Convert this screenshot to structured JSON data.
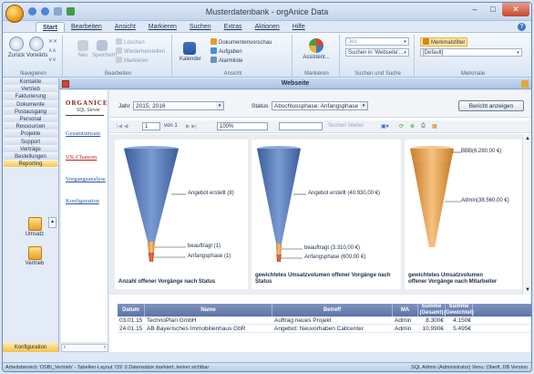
{
  "window": {
    "title": "Musterdatenbank - orgAnice Data",
    "minimize": "–",
    "maximize": "□",
    "close": "✕"
  },
  "tabs": [
    "Start",
    "Bearbeiten",
    "Ansicht",
    "Markieren",
    "Suchen",
    "Extras",
    "Aktionen",
    "Hilfe"
  ],
  "ribbon": {
    "navigation": {
      "label": "Navigieren",
      "back": "Zurück",
      "forward": "Vorwärts"
    },
    "edit": {
      "label": "Bearbeiten",
      "new": "Neu",
      "save": "Speichern",
      "delete": "Löschen",
      "restore": "Wiederherstellen",
      "mark": "Markieren"
    },
    "view": {
      "label": "Ansicht",
      "calendar": "Kalender",
      "documents": "Dokumentenvorschau",
      "tasks": "Aufgaben",
      "lists": "Alarmliste"
    },
    "markers": {
      "label": "Markieren",
      "assistant": "Assistent..."
    },
    "search": {
      "label": "Suchen und Suche",
      "value": "Suchen in 'Webseite'..."
    },
    "fields": {
      "label": "Merkmale",
      "title": "Merkmalsfilter",
      "value": "[Default]"
    }
  },
  "nav": {
    "items": [
      "Kontakte",
      "Vertrieb",
      "Fakturierung",
      "Dokumente",
      "Postausgang",
      "Personal",
      "Ressourcen",
      "Projekte",
      "Support",
      "Verträge",
      "Bestellungen",
      "Reporting"
    ],
    "active": "Reporting",
    "icons": [
      "Umsatz",
      "Vertrieb"
    ],
    "footer": "Konfiguration"
  },
  "panel": {
    "title": "Webseite"
  },
  "linkpane": {
    "logo_top": "ORGANICE",
    "logo_bottom": "SQL Server",
    "links": [
      "Gesamtumsatz",
      "VK-Chancen",
      "Vorgangsanalyse",
      "Konfiguration"
    ]
  },
  "filter": {
    "year_label": "Jahr",
    "year_value": "2015; 2016",
    "status_label": "Status",
    "status_value": "Abschlussphase; Anfangsphase",
    "button": "Bericht anzeigen"
  },
  "report_toolbar": {
    "page": "1",
    "of": "von 1",
    "zoom": "100%",
    "search_hint": "Suchen",
    "next": "Weiter"
  },
  "charts": [
    {
      "type": "funnel",
      "title": "Anzahl offener Vorgänge nach Status",
      "segments": [
        {
          "label": "Angebot erstellt (8)",
          "value": 8
        },
        {
          "label": "beauftragt (1)",
          "value": 1
        },
        {
          "label": "Anfangsphase (1)",
          "value": 1
        }
      ]
    },
    {
      "type": "funnel",
      "title": "gewichtetes Umsatzvolumen offener Vorgänge nach Status",
      "segments": [
        {
          "label": "Angebot erstellt (40.930,00 €)",
          "value": 40930
        },
        {
          "label": "beauftragt (3.310,00 €)",
          "value": 3310
        },
        {
          "label": "Anfangsphase (600,00 €)",
          "value": 600
        }
      ]
    },
    {
      "type": "funnel",
      "title": "gewichtetes Umsatzvolumen offener Vorgänge nach Mitarbeiter",
      "segments": [
        {
          "label": "BBB(6.280,00 €)",
          "value": 6280
        },
        {
          "label": "Admin(38.560,00 €)",
          "value": 38560
        }
      ]
    }
  ],
  "chart_data": [
    {
      "type": "funnel",
      "title": "Anzahl offener Vorgänge nach Status",
      "categories": [
        "Angebot erstellt",
        "beauftragt",
        "Anfangsphase"
      ],
      "values": [
        8,
        1,
        1
      ]
    },
    {
      "type": "funnel",
      "title": "gewichtetes Umsatzvolumen offener Vorgänge nach Status",
      "categories": [
        "Angebot erstellt",
        "beauftragt",
        "Anfangsphase"
      ],
      "values": [
        40930,
        3310,
        600
      ]
    },
    {
      "type": "funnel",
      "title": "gewichtetes Umsatzvolumen offener Vorgänge nach Mitarbeiter",
      "categories": [
        "BBB",
        "Admin"
      ],
      "values": [
        6280,
        38560
      ]
    }
  ],
  "table": {
    "headers": [
      "Datum",
      "Name",
      "Betreff",
      "MA",
      "Summe (Gesamt)",
      "Summe (Gewichtet)"
    ],
    "rows": [
      [
        "03.01.15",
        "TechnoPlan GmbH",
        "Auftrag neues Projekt",
        "Admin",
        "8.300€",
        "4.150€"
      ],
      [
        "24.01.15",
        "AB Bayerisches Immobilienhaus GbR",
        "Angebot: Neuvorhaben Callcenter",
        "Admin",
        "10.990€",
        "5.495€"
      ]
    ]
  },
  "status": {
    "left": "Arbeitsbereich 'OSBI_Vertrieb' - Tabellen-Layout 'OS' 0 Datensätze markiert, keiner sichtbar",
    "right": "SQL Admin (Administrator)   Venu: Oberfl, DB Version"
  },
  "colors": {
    "funnel_blue": "#5d7fba",
    "funnel_orange": "#e9a55a",
    "funnel_red": "#d7401c",
    "accent": "#f2c24e"
  }
}
